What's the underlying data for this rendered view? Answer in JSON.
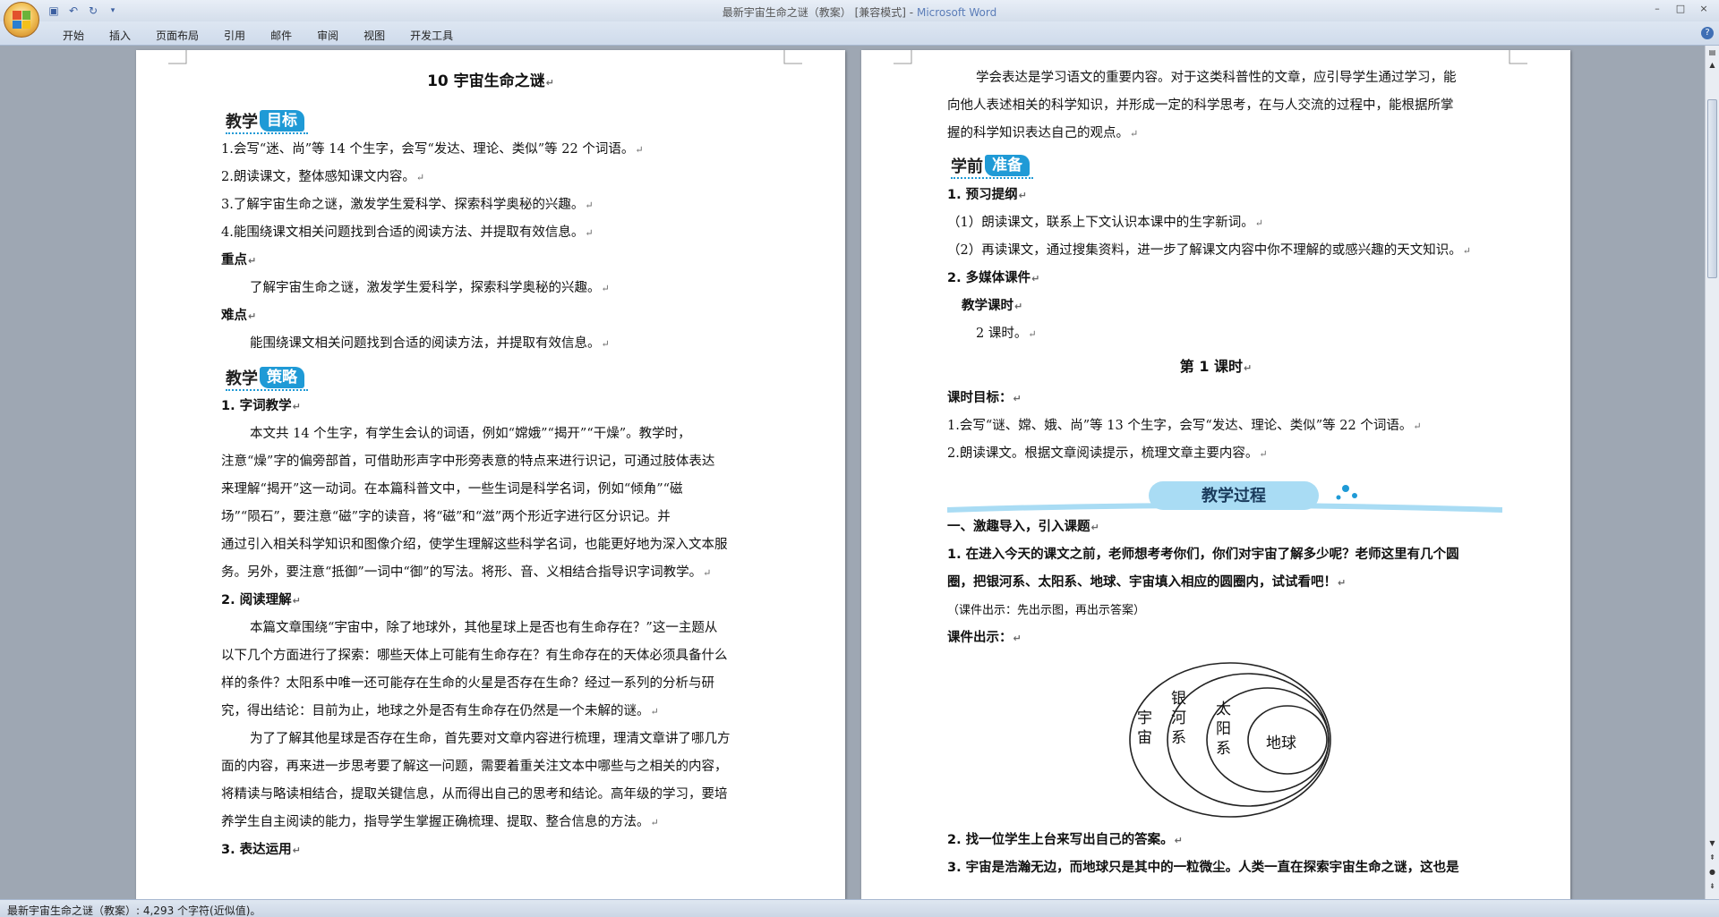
{
  "window": {
    "title_doc": "最新宇宙生命之谜（教案）",
    "title_mode": "[兼容模式]",
    "title_sep": "-",
    "title_app": "Microsoft Word",
    "controls": [
      "–",
      "□",
      "×"
    ]
  },
  "ribbon": {
    "tabs": [
      "开始",
      "插入",
      "页面布局",
      "引用",
      "邮件",
      "审阅",
      "视图",
      "开发工具"
    ],
    "help": "?"
  },
  "status": {
    "text": "最新宇宙生命之谜（教案）: 4,293 个字符(近似值)。"
  },
  "left_page": {
    "title": "10  宇宙生命之谜",
    "banner1": {
      "a": "教学",
      "b": "目标"
    },
    "goals": [
      "1.会写“迷、尚”等 14 个生字，会写“发达、理论、类似”等 22 个词语。",
      "2.朗读课文，整体感知课文内容。",
      "3.了解宇宙生命之谜，激发学生爱科学、探索科学奥秘的兴趣。",
      "4.能围绕课文相关问题找到合适的阅读方法、并提取有效信息。"
    ],
    "key_label": "重点",
    "key_text": "了解宇宙生命之谜，激发学生爱科学，探索科学奥秘的兴趣。",
    "diff_label": "难点",
    "diff_text": "能围绕课文相关问题找到合适的阅读方法，并提取有效信息。",
    "banner2": {
      "a": "教学",
      "b": "策略"
    },
    "s1_title": "1. 字词教学",
    "s1_lines": [
      "本文共 14 个生字，有学生会认的词语，例如“嫦娥”“揭开”“干燥”。教学时，",
      "注意“燥”字的偏旁部首，可借助形声字中形旁表意的特点来进行识记，可通过肢体表达",
      "来理解“揭开”这一动词。在本篇科普文中，一些生词是科学名词，例如“倾角”“磁",
      "场”“陨石”，要注意“磁”字的读音，将“磁”和“滋”两个形近字进行区分识记。并",
      "通过引入相关科学知识和图像介绍，使学生理解这些科学名词，也能更好地为深入文本服",
      "务。另外，要注意“抵御”一词中“御”的写法。将形、音、义相结合指导识字词教学。"
    ],
    "s2_title": "2. 阅读理解",
    "s2_lines": [
      "本篇文章围绕“宇宙中，除了地球外，其他星球上是否也有生命存在？”这一主题从",
      "以下几个方面进行了探索：哪些天体上可能有生命存在？有生命存在的天体必须具备什么",
      "样的条件？太阳系中唯一还可能存在生命的火星是否存在生命？经过一系列的分析与研",
      "究，得出结论：目前为止，地球之外是否有生命存在仍然是一个未解的谜。"
    ],
    "s2b_lines": [
      "为了了解其他星球是否存在生命，首先要对文章内容进行梳理，理清文章讲了哪几方",
      "面的内容，再来进一步思考要了解这一问题，需要着重关注文本中哪些与之相关的内容，",
      "将精读与略读相结合，提取关键信息，从而得出自己的思考和结论。高年级的学习，要培",
      "养学生自主阅读的能力，指导学生掌握正确梳理、提取、整合信息的方法。"
    ],
    "s3_title": "3. 表达运用"
  },
  "right_page": {
    "intro_lines": [
      "学会表达是学习语文的重要内容。对于这类科普性的文章，应引导学生通过学习，能",
      "向他人表述相关的科学知识，并形成一定的科学思考，在与人交流的过程中，能根据所掌",
      "握的科学知识表达自己的观点。"
    ],
    "banner": {
      "a": "学前",
      "b": "准备"
    },
    "p1_title": "1. 预习提纲",
    "p1_items": [
      "（1）朗读课文，联系上下文认识本课中的生字新词。",
      "（2）再读课文，通过搜集资料，进一步了解课文内容中你不理解的或感兴趣的天文知识。"
    ],
    "p2_title": "2. 多媒体课件",
    "hours_label": "教学课时",
    "hours_value": "2 课时。",
    "lesson_title": "第 1 课时",
    "lesson_goal_label": "课时目标：",
    "lesson_goals": [
      "1.会写“谜、嫦、娥、尚”等 13 个生字，会写“发达、理论、类似”等 22 个词语。",
      "2.朗读课文。根据文章阅读提示，梳理文章主要内容。"
    ],
    "process_banner": "教学过程",
    "step1": "一、激趣导入，引入课题",
    "q1_lines": [
      "1. 在进入今天的课文之前，老师想考考你们，你们对宇宙了解多少呢？老师这里有几个圆",
      "圈，把银河系、太阳系、地球、宇宙填入相应的圆圈内，试试看吧！"
    ],
    "courseware_note": "（课件出示：先出示图，再出示答案）",
    "courseware_label": "课件出示：",
    "diagram": {
      "yuzhou": [
        "宇",
        "宙"
      ],
      "yinhe": [
        "银",
        "河",
        "系"
      ],
      "taiyang": [
        "太",
        "阳",
        "系"
      ],
      "diqiu": "地球"
    },
    "q2": "2. 找一位学生上台来写出自己的答案。",
    "q3": "3. 宇宙是浩瀚无边，而地球只是其中的一粒微尘。人类一直在探索宇宙生命之谜，这也是"
  },
  "colors": {
    "accent_blue": "#1f9ad6",
    "process_blue": "#a9dcf4"
  },
  "icons": [
    "office-button-icon",
    "save-icon",
    "undo-icon",
    "redo-icon",
    "customize-icon",
    "help-icon",
    "paragraph-mark-icon"
  ]
}
